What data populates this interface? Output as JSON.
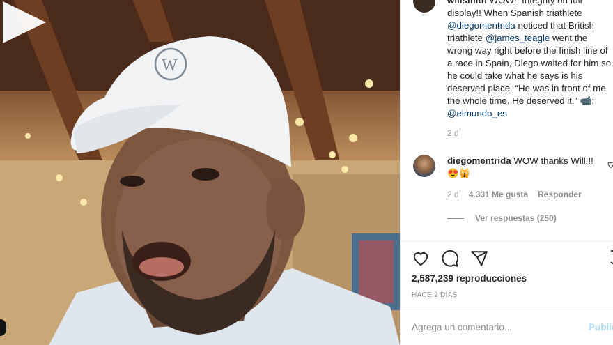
{
  "post": {
    "caption_user": "willsmith",
    "caption_text_1": "WOW!! Integrity on full display!! When Spanish triathlete",
    "mention_1": "@diegomentrida",
    "caption_text_2": "noticed that British triathlete",
    "mention_2": "@james_teagle",
    "caption_text_3": "went the wrong way right before the finish line of a race in Spain, Diego waited for him so he could take what he says is his deserved place. “He was in front of me the whole time. He deserved it.”",
    "caption_emoji": "📹",
    "mention_3": "@elmundo_es",
    "caption_time": "2 d"
  },
  "comment": {
    "user": "diegomentrida",
    "text": "WOW thanks Will!!! 😍🙀",
    "time": "2 d",
    "likes": "4.331 Me gusta",
    "reply_label": "Responder",
    "view_replies": "Ver respuestas (250)"
  },
  "stats": {
    "views_count": "2,587,239",
    "views_label": "reproducciones",
    "posted": "HACE 2 DÍAS"
  },
  "composer": {
    "placeholder": "Agrega un comentario...",
    "publish_label": "Publicar"
  },
  "icons": {
    "play": "play-icon",
    "heart": "heart-icon",
    "comment": "comment-icon",
    "share": "share-icon",
    "bookmark": "bookmark-icon"
  },
  "colors": {
    "link": "#00376b",
    "muted": "#8e8e8e",
    "publish_disabled": "#b2dffc"
  }
}
